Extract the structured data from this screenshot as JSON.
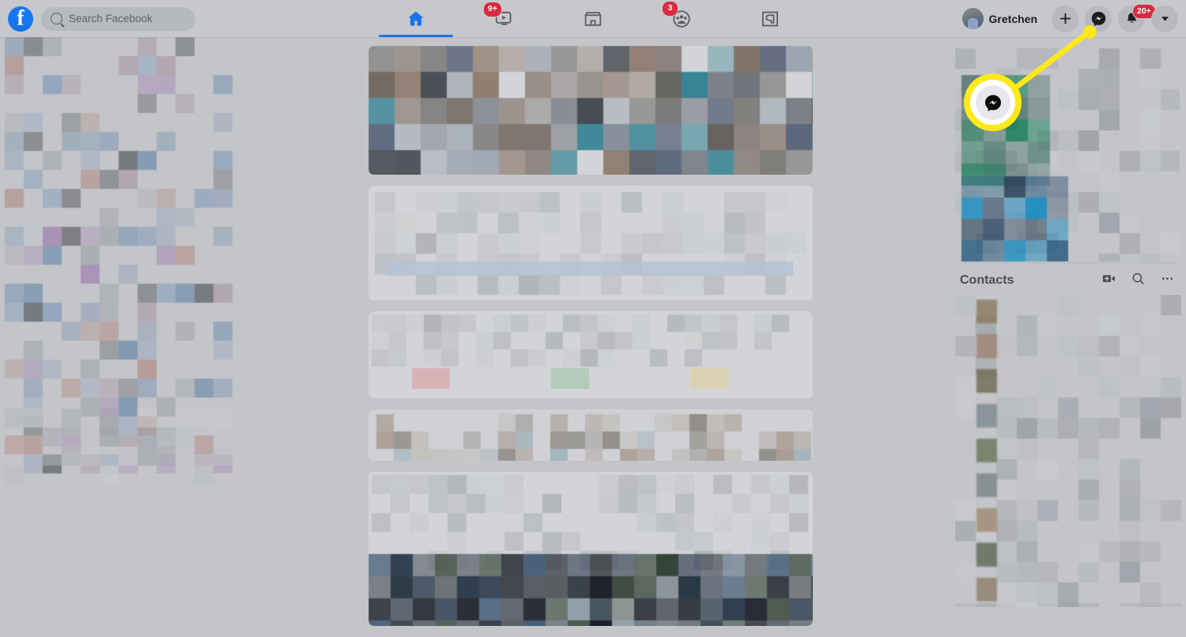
{
  "app": {
    "name": "Facebook",
    "logo_icon": "facebook-logo-icon",
    "accent_color": "#1877f2",
    "active_tab_color": "#1b74e4",
    "badge_color": "#d92b3f",
    "highlight_color": "#ffe81c",
    "topbar_bg": "#c6c8cb",
    "page_bg": "#c3c5c9",
    "card_bg": "#d2d4d7"
  },
  "search": {
    "placeholder": "Search Facebook",
    "value": "",
    "icon": "search-icon"
  },
  "nav_tabs": [
    {
      "name": "home",
      "icon": "home-icon",
      "label": "Home",
      "active": true,
      "badge": ""
    },
    {
      "name": "watch",
      "icon": "video-icon",
      "label": "Watch",
      "active": false,
      "badge": "9+"
    },
    {
      "name": "marketplace",
      "icon": "marketplace-icon",
      "label": "Marketplace",
      "active": false,
      "badge": ""
    },
    {
      "name": "groups",
      "icon": "groups-icon",
      "label": "Groups",
      "active": false,
      "badge": "3"
    },
    {
      "name": "gaming",
      "icon": "gaming-icon",
      "label": "Gaming",
      "active": false,
      "badge": ""
    }
  ],
  "account": {
    "profile_name": "Gretchen",
    "avatar_icon": "avatar",
    "buttons": [
      {
        "name": "create",
        "icon": "plus-icon",
        "label": "Create",
        "badge": ""
      },
      {
        "name": "messenger",
        "icon": "messenger-icon",
        "label": "Messenger",
        "badge": ""
      },
      {
        "name": "notifications",
        "icon": "bell-icon",
        "label": "Notifications",
        "badge": "20+"
      },
      {
        "name": "account-menu",
        "icon": "chevron-down-icon",
        "label": "Account",
        "badge": ""
      }
    ]
  },
  "contacts": {
    "title": "Contacts",
    "actions": [
      {
        "name": "new-room",
        "icon": "video-plus-icon"
      },
      {
        "name": "search-contacts",
        "icon": "search-icon"
      },
      {
        "name": "contacts-options",
        "icon": "more-options-icon"
      }
    ]
  },
  "annotation": {
    "type": "callout",
    "highlight_icon": "messenger-icon",
    "color": "#ffe81c",
    "points_from": "messenger-button-topbar",
    "points_to": "messenger-icon-highlight"
  },
  "content_state": {
    "note": "feed, left shortcuts, right sponsored panel and contacts list are blurred/pixelated"
  }
}
